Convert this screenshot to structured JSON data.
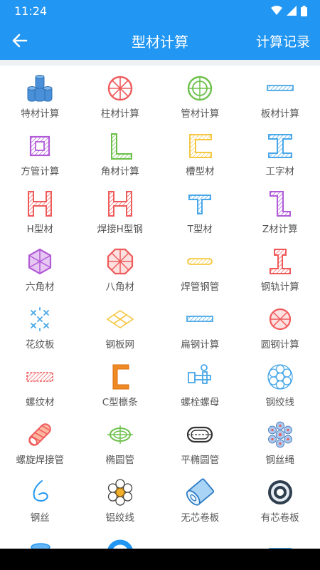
{
  "status": {
    "time": "11:24"
  },
  "header": {
    "title": "型材计算",
    "records": "计算记录"
  },
  "items": [
    {
      "label": "特材计算",
      "icon": "special-material-icon"
    },
    {
      "label": "柱材计算",
      "icon": "round-bar-icon"
    },
    {
      "label": "管材计算",
      "icon": "pipe-icon"
    },
    {
      "label": "板材计算",
      "icon": "plate-icon"
    },
    {
      "label": "方管计算",
      "icon": "square-tube-icon"
    },
    {
      "label": "角材计算",
      "icon": "angle-steel-icon"
    },
    {
      "label": "槽型材",
      "icon": "channel-steel-icon"
    },
    {
      "label": "工字材",
      "icon": "i-beam-icon"
    },
    {
      "label": "H型材",
      "icon": "h-beam-icon"
    },
    {
      "label": "焊接H型钢",
      "icon": "welded-h-beam-icon"
    },
    {
      "label": "T型材",
      "icon": "t-bar-icon"
    },
    {
      "label": "Z材计算",
      "icon": "z-bar-icon"
    },
    {
      "label": "六角材",
      "icon": "hexagon-bar-icon"
    },
    {
      "label": "八角材",
      "icon": "octagon-bar-icon"
    },
    {
      "label": "焊管钢管",
      "icon": "welded-pipe-icon"
    },
    {
      "label": "钢轨计算",
      "icon": "rail-icon"
    },
    {
      "label": "花纹板",
      "icon": "checkered-plate-icon"
    },
    {
      "label": "钢板网",
      "icon": "expanded-metal-icon"
    },
    {
      "label": "扁钢计算",
      "icon": "flat-bar-icon"
    },
    {
      "label": "圆钢计算",
      "icon": "round-steel-icon"
    },
    {
      "label": "螺纹材",
      "icon": "rebar-icon"
    },
    {
      "label": "C型檩条",
      "icon": "c-purlin-icon"
    },
    {
      "label": "螺栓螺母",
      "icon": "bolt-nut-icon"
    },
    {
      "label": "钢绞线",
      "icon": "strand-icon"
    },
    {
      "label": "螺旋焊接管",
      "icon": "spiral-pipe-icon"
    },
    {
      "label": "椭圆管",
      "icon": "oval-tube-icon"
    },
    {
      "label": "平椭圆管",
      "icon": "flat-oval-tube-icon"
    },
    {
      "label": "钢丝绳",
      "icon": "wire-rope-icon"
    },
    {
      "label": "钢丝",
      "icon": "wire-icon"
    },
    {
      "label": "铝绞线",
      "icon": "aluminum-strand-icon"
    },
    {
      "label": "无芯卷板",
      "icon": "coreless-coil-icon"
    },
    {
      "label": "有芯卷板",
      "icon": "cored-coil-icon"
    },
    {
      "label": "",
      "icon": "cylinder-icon"
    },
    {
      "label": "",
      "icon": "ring-icon"
    },
    {
      "label": "",
      "icon": "grating-icon"
    },
    {
      "label": "",
      "icon": "mesh-icon"
    }
  ],
  "colors": {
    "primary": "#2196f3",
    "background": "#ffffff",
    "label": "#555555"
  }
}
